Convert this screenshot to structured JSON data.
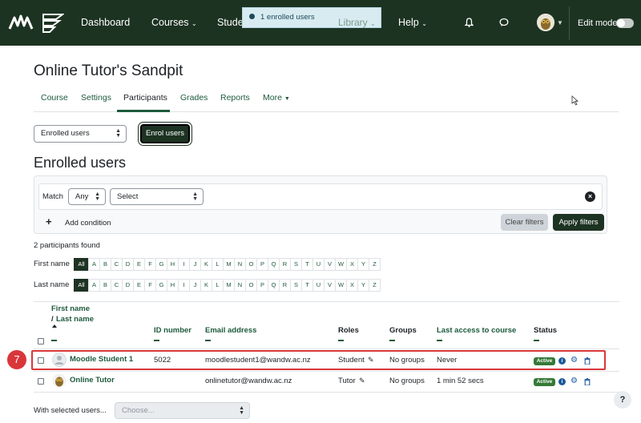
{
  "navbar": {
    "items": [
      "Dashboard",
      "Courses",
      "Students",
      "Library",
      "Help"
    ],
    "edit_mode_label": "Edit mode"
  },
  "toast": {
    "message": "1 enrolled users"
  },
  "course": {
    "title": "Online Tutor's Sandpit"
  },
  "tabs": [
    "Course",
    "Settings",
    "Participants",
    "Grades",
    "Reports",
    "More"
  ],
  "controls": {
    "enrolled_select": "Enrolled users",
    "enrol_button": "Enrol users",
    "section_heading": "Enrolled users"
  },
  "filter": {
    "match_label": "Match",
    "match_value": "Any",
    "type_value": "Select",
    "add_condition": "Add condition",
    "clear_filters": "Clear filters",
    "apply_filters": "Apply filters"
  },
  "participants_found": "2 participants found",
  "initials": {
    "firstname_label": "First name",
    "lastname_label": "Last name",
    "letters": [
      "All",
      "A",
      "B",
      "C",
      "D",
      "E",
      "F",
      "G",
      "H",
      "I",
      "J",
      "K",
      "L",
      "M",
      "N",
      "O",
      "P",
      "Q",
      "R",
      "S",
      "T",
      "U",
      "V",
      "W",
      "X",
      "Y",
      "Z"
    ]
  },
  "table": {
    "headers": {
      "first_name": "First name",
      "separator": "/",
      "last_name": "Last name",
      "id_number": "ID number",
      "email": "Email address",
      "roles": "Roles",
      "groups": "Groups",
      "last_access": "Last access to course",
      "status": "Status"
    },
    "rows": [
      {
        "name": "Moodle Student 1",
        "id_number": "5022",
        "email": "moodlestudent1@wandw.ac.nz",
        "role": "Student",
        "groups": "No groups",
        "last_access": "Never",
        "status": "Active"
      },
      {
        "name": "Online Tutor",
        "id_number": "",
        "email": "onlinetutor@wandw.ac.nz",
        "role": "Tutor",
        "groups": "No groups",
        "last_access": "1 min 52 secs",
        "status": "Active"
      }
    ]
  },
  "annotation": {
    "step": "7"
  },
  "bulk": {
    "label": "With selected users...",
    "placeholder": "Choose..."
  },
  "help": "?"
}
